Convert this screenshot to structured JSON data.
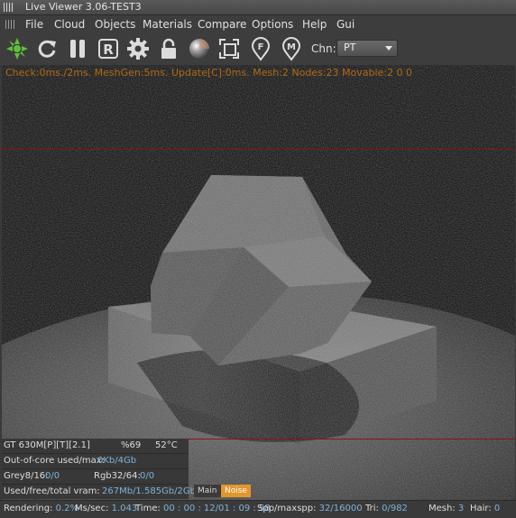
{
  "window": {
    "title": "Live Viewer 3.06-TEST3"
  },
  "menu": [
    "File",
    "Cloud",
    "Objects",
    "Materials",
    "Compare",
    "Options",
    "Help",
    "Gui"
  ],
  "toolbar": {
    "icons": [
      "octane-logo-icon",
      "refresh-icon",
      "pause-icon",
      "r-reset-icon",
      "gear-icon",
      "lock-icon",
      "material-ball-icon",
      "focus-frame-icon",
      "f-pin-icon",
      "m-pin-icon"
    ],
    "channel_label": "Chn:",
    "channel_value": "PT"
  },
  "viewport": {
    "stats_line": "Check:0ms./2ms. MeshGen:5ms. Update[C]:0ms. Mesh:2 Nodes:23 Movable:2  0 0"
  },
  "info_panel": {
    "gpu": "GT 630M[P][T][2.1]",
    "gpu_usage": "%69",
    "gpu_temp": "52°C",
    "ooc_label": "Out-of-core used/max:",
    "ooc_value": "0Kb/4Gb",
    "grey_label": "Grey8/16:",
    "grey_value": "0/0",
    "rgb_label": "Rgb32/64:",
    "rgb_value": "0/0",
    "vram_label": "Used/free/total vram:",
    "vram_value": "267Mb/1.585Gb/2Gb"
  },
  "tabs": [
    "Main",
    "Noise"
  ],
  "status": {
    "rendering_label": "Rendering:",
    "rendering_value": "0.2%",
    "ms_label": "Ms/sec:",
    "ms_value": "1.043",
    "time_label": "Time:",
    "time_value": "00 : 00 : 12/01 : 09 : 58",
    "spp_label": "Spp/maxspp:",
    "spp_value": "32/16000",
    "tri_label": "Tri:",
    "tri_value": "0/982",
    "mesh_label": "Mesh:",
    "mesh_value": "3",
    "hair_label": "Hair:",
    "hair_value": "0"
  },
  "colors": {
    "accent": "#e4962c",
    "stats_text": "#b06a17",
    "value_text": "#7fb2d9",
    "guide_line": "#8b1414",
    "logo_green": "#5ec03a"
  }
}
